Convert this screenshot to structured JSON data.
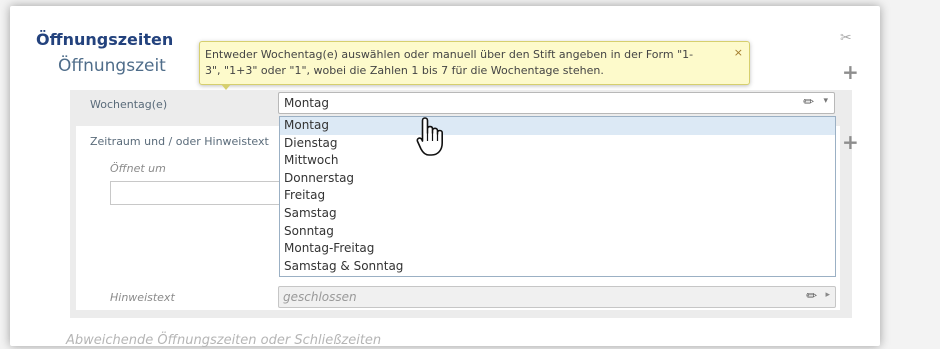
{
  "section": {
    "title": "Öffnungszeiten",
    "subtitle": "Öffnungszeit"
  },
  "tooltip": {
    "line1": "Entweder Wochentag(e) auswählen oder manuell über den Stift angeben in der Form \"1-",
    "line2": "3\", \"1+3\" oder \"1\", wobei die Zahlen 1 bis 7 für die Wochentage stehen.",
    "close": "×"
  },
  "icons": {
    "scissors": "✂",
    "plus": "+",
    "pencil": "✏",
    "caret_down": "▾",
    "caret_right": "▸"
  },
  "fields": {
    "wochentag_label": "Wochentag(e)",
    "wochentag_value": "Montag",
    "zeitraum_label": "Zeitraum und / oder Hinweistext",
    "oeffnet_label": "Öffnet um",
    "hinweis_label": "Hinweistext",
    "hinweis_value": "geschlossen"
  },
  "dropdown": {
    "options": [
      "Montag",
      "Dienstag",
      "Mittwoch",
      "Donnerstag",
      "Freitag",
      "Samstag",
      "Sonntag",
      "Montag-Freitag",
      "Samstag & Sonntag"
    ],
    "highlighted": "Montag"
  },
  "footer": {
    "text": "Abweichende Öffnungszeiten oder Schließzeiten"
  }
}
